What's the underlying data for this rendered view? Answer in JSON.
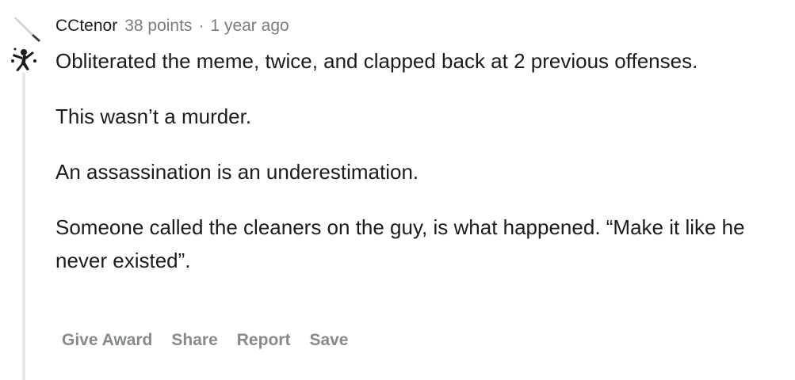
{
  "comment": {
    "author": "CCtenor",
    "points": "38 points",
    "separator": "·",
    "age": "1 year ago",
    "paragraphs": [
      "Obliterated the meme, twice, and clapped back at 2 previous offenses.",
      "This wasn’t a murder.",
      "An assassination is an underestimation.",
      "Someone called the cleaners on the guy, is what happened. “Make it like he never existed”."
    ],
    "actions": {
      "give_award": "Give Award",
      "share": "Share",
      "report": "Report",
      "save": "Save"
    }
  },
  "icons": {
    "flair": "knife-icon",
    "avatar": "user-avatar-icon"
  },
  "colors": {
    "text": "#1c1c1c",
    "meta": "#7c7c7c",
    "action": "#878a8c",
    "thread_line": "#e8e8e8"
  }
}
